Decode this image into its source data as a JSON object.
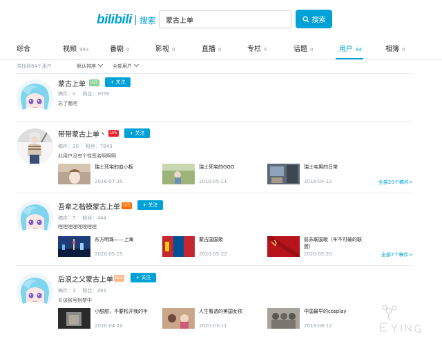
{
  "header": {
    "logo_word": "bilibili",
    "logo_text": "搜索",
    "search_value": "蒙古上单",
    "search_button": "搜索"
  },
  "tabs": [
    {
      "label": "综合",
      "count": ""
    },
    {
      "label": "视频",
      "count": "99+"
    },
    {
      "label": "番剧",
      "count": "0"
    },
    {
      "label": "影视",
      "count": "0"
    },
    {
      "label": "直播",
      "count": "0"
    },
    {
      "label": "专栏",
      "count": "5"
    },
    {
      "label": "话题",
      "count": "0"
    },
    {
      "label": "用户",
      "count": "84"
    },
    {
      "label": "相簿",
      "count": "0"
    }
  ],
  "filter": {
    "result_count": "共找到84个用户",
    "sort": "默认排序",
    "user_type": "全部用户"
  },
  "follow_label": "+ 关注",
  "users": [
    {
      "name": "蒙古上单",
      "level": "LV2",
      "level_color": "#8bd29b",
      "videos": "稿件：0",
      "fans": "粉丝：3056",
      "sign": "忘了我吧",
      "works": [],
      "more": ""
    },
    {
      "name": "带带蒙古上单丶",
      "level": "LV6",
      "level_color": "#ee1f2a",
      "videos": "稿件：20",
      "fans": "粉丝：7843",
      "sign": "此用户没有个性签名啊啊啊",
      "works": [
        {
          "title": "瑞士死宅的血小板",
          "date": "2018-07-30"
        },
        {
          "title": "瑞士死宅的GGO",
          "date": "2018-05-11"
        },
        {
          "title": "瑞士宅男的日常",
          "date": "2018-04-12"
        }
      ],
      "more": "全部20个稿件>"
    },
    {
      "name": "吾辈之楷模蒙古上单",
      "level": "LV5",
      "level_color": "#ff6c00",
      "videos": "稿件：7",
      "fans": "粉丝：444",
      "sign": "嘿嘿嘿嘿嘿嘿嘿嘿",
      "works": [
        {
          "title": "东方明珠——上海",
          "date": "2020-05-25"
        },
        {
          "title": "蒙古国国歌",
          "date": "2020-05-22"
        },
        {
          "title": "前苏联国歌（牢不可破的联盟）",
          "date": "2020-05-20"
        }
      ],
      "more": "全部7个稿件>"
    },
    {
      "name": "后浪之父蒙古上单",
      "level": "LV3",
      "level_color": "#feb989",
      "videos": "稿件：3",
      "fans": "粉丝：393",
      "sign": "©该账号封禁中",
      "works": [
        {
          "title": "小甜甜，不要松开我的手",
          "date": "2020-04-20"
        },
        {
          "title": "人生看透的美国女孩",
          "date": "2020-03-11"
        },
        {
          "title": "中国最早的cosplay",
          "date": "2019-08-12"
        }
      ],
      "more": ""
    }
  ],
  "colors": {
    "accent": "#00a1d6",
    "muted": "#99a2aa",
    "divider": "#e5e9ef"
  }
}
